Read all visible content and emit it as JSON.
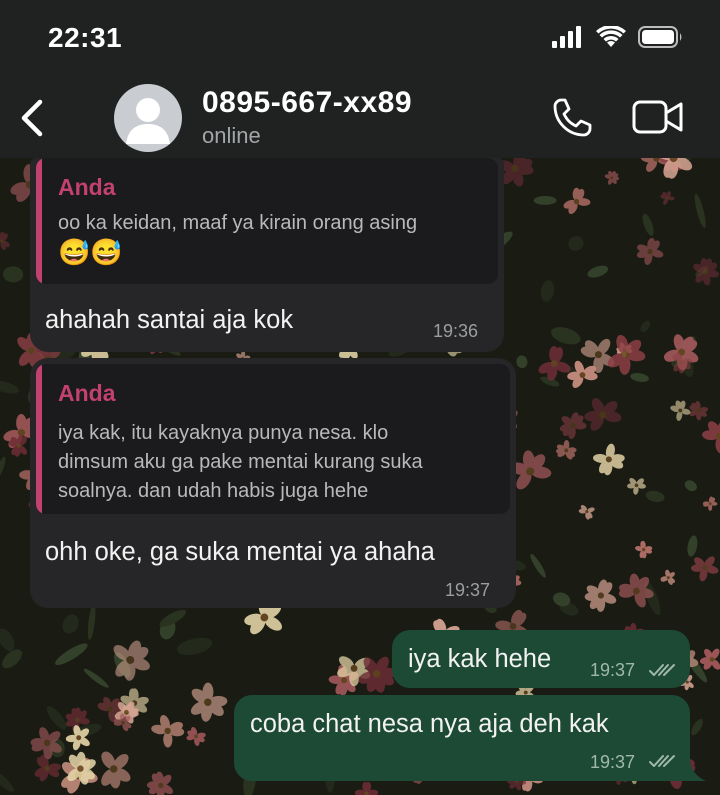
{
  "status_bar": {
    "time": "22:31"
  },
  "header": {
    "contact_name": "0895-667-xx89",
    "contact_status": "online"
  },
  "messages": [
    {
      "direction": "incoming",
      "quote_author": "Anda",
      "quote_text": "oo ka keidan, maaf ya kirain orang asing",
      "quote_emoji": "😅😅",
      "text": "ahahah santai aja kok",
      "time": "19:36"
    },
    {
      "direction": "incoming",
      "quote_author": "Anda",
      "quote_lines": [
        "iya kak, itu kayaknya punya nesa. klo",
        "dimsum aku ga pake mentai kurang suka",
        "soalnya. dan udah habis juga hehe"
      ],
      "text": "ohh oke, ga suka mentai ya ahaha",
      "time": "19:37"
    },
    {
      "direction": "outgoing",
      "text": "iya kak hehe",
      "time": "19:37",
      "status": "read"
    },
    {
      "direction": "outgoing",
      "text": "coba chat nesa nya aja deh kak",
      "time": "19:37",
      "status": "read"
    }
  ],
  "colors": {
    "incoming_bubble": "#262628",
    "outgoing_bubble": "#1d4a35",
    "quote_accent": "#c2416d",
    "header_bg": "#1f2220"
  }
}
